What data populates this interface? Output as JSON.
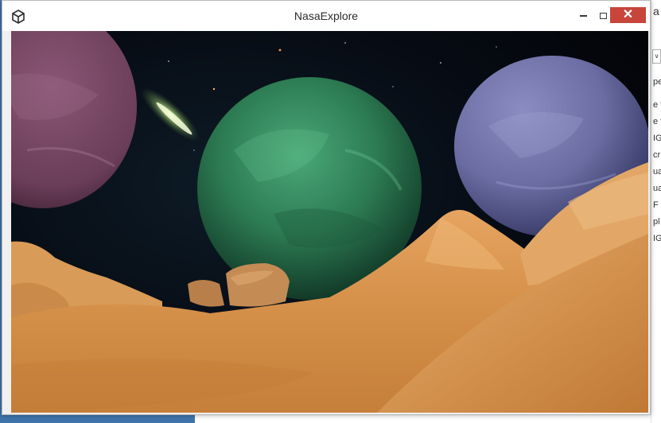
{
  "window": {
    "title": "NasaExplore",
    "app_icon": "unity-icon",
    "controls": {
      "minimize_icon": "minimize-icon",
      "maximize_icon": "maximize-icon",
      "close_icon": "close-icon",
      "close_glyph": "✕"
    }
  },
  "background_window": {
    "side_fragments": [
      "a",
      "pe",
      "e f",
      "e f",
      "IG",
      "cr",
      "ua",
      "ua",
      "F F",
      "pl",
      "IG"
    ]
  },
  "scene": {
    "objects": [
      "starfield",
      "nebula-streak",
      "pink-planet",
      "green-planet",
      "blue-planet",
      "desert-terrain",
      "boulder"
    ],
    "colors": {
      "space": "#05070d",
      "pink_planet": "#7a4a66",
      "green_planet": "#2f8a5c",
      "blue_planet": "#6d6fa3",
      "terrain": "#d9954f",
      "close_button": "#c7453a"
    }
  }
}
